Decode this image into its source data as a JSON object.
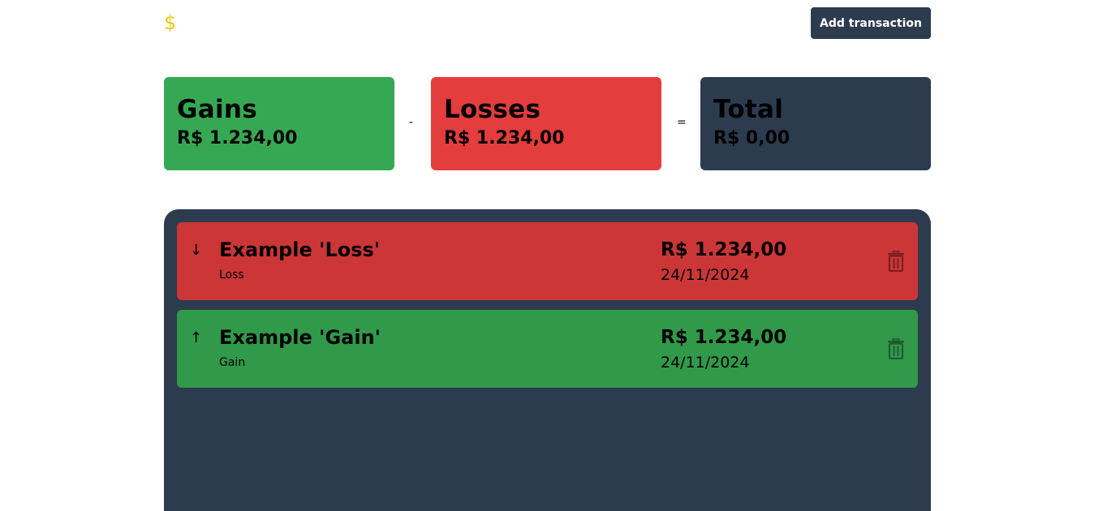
{
  "header": {
    "logo": "$",
    "add_button_label": "Add transaction"
  },
  "summary": {
    "gains": {
      "title": "Gains",
      "value": "R$ 1.234,00"
    },
    "minus_operator": "-",
    "losses": {
      "title": "Losses",
      "value": "R$ 1.234,00"
    },
    "equals_operator": "=",
    "total": {
      "title": "Total",
      "value": "R$ 0,00"
    }
  },
  "transactions": [
    {
      "arrow": "↓",
      "name": "Example 'Loss'",
      "type": "Loss",
      "amount": "R$ 1.234,00",
      "date": "24/11/2024",
      "icon": "arrow-down-icon"
    },
    {
      "arrow": "↑",
      "name": "Example 'Gain'",
      "type": "Gain",
      "amount": "R$ 1.234,00",
      "date": "24/11/2024",
      "icon": "arrow-up-icon"
    }
  ],
  "colors": {
    "gain": "#36a853",
    "loss": "#e33d3d",
    "dark": "#2d3b4f",
    "logo": "#e8c91a"
  }
}
